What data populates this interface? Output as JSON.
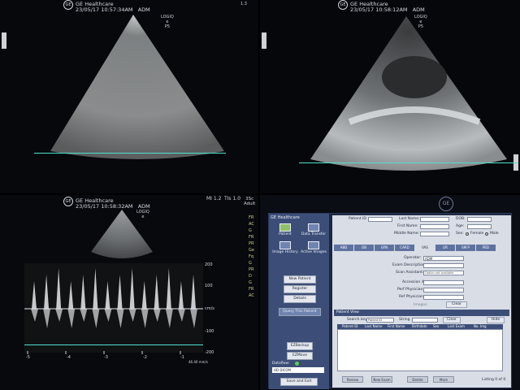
{
  "panel1": {
    "brand": "GE Healthcare",
    "timestamp": "23/05/17 10:57:34AM",
    "operator": "ADM",
    "readout": "1.3",
    "probe_lines": [
      "LOGIQ",
      "e",
      "P5"
    ]
  },
  "panel2": {
    "brand": "GE Healthcare",
    "timestamp": "23/05/17 10:58:12AM",
    "operator": "ADM",
    "probe_lines": [
      "LOGIQ",
      "e",
      "P5"
    ]
  },
  "panel3": {
    "brand": "GE Healthcare",
    "timestamp": "23/05/17 10:58:32AM",
    "operator": "ADM",
    "mi": "MI 1.2",
    "tis": "TIs 1.0",
    "preset_lines": [
      "3Sc",
      "Adult"
    ],
    "probe_lines": [
      "LOGIQ",
      "e"
    ],
    "right_params": [
      "FR",
      "AC",
      "G",
      "FR",
      "PR",
      "Ge",
      "Fq",
      "G",
      "PR",
      "D",
      "G",
      "FR",
      "AC"
    ],
    "scale_labels": [
      "200",
      "100",
      "cm/s",
      "-100",
      "-200"
    ],
    "time_ticks": [
      "-5",
      "-4",
      "-3",
      "-2",
      "-1"
    ],
    "duration": "46.40 mm/s"
  },
  "panel4": {
    "brand": "GE Healthcare",
    "tiles": {
      "patient": "Patient",
      "data_transfer": "Data Transfer",
      "image_history": "Image History",
      "active_images": "Active Images"
    },
    "buttons": {
      "new_patient": "New Patient",
      "register": "Register",
      "details": "Details",
      "query_this_patient": "Query This Patient",
      "ezbackup": "EZBackup",
      "ezmove": "EZMove",
      "save_and_exit": "Save and Exit",
      "clear": "Clear",
      "hide": "Hide",
      "clear_search": "Clear"
    },
    "dataflow_label": "Dataflow:",
    "dataflow_value": "HD DICOM",
    "fields": {
      "patient_id": "Patient ID",
      "last_name": "Last Name:",
      "first_name": "First Name:",
      "middle_name": "Middle Name:",
      "dob": "DOB:",
      "age": "Age:",
      "sex": "Sex:",
      "female": "Female",
      "male": "Male"
    },
    "tabs": [
      "ABD",
      "OB",
      "GYN",
      "CARD",
      "VAS",
      "UR",
      "SM P",
      "PED"
    ],
    "active_tab": 4,
    "exam": {
      "operator_label": "Operator:",
      "operator_value": "ADM",
      "exam_desc": "Exam Description:",
      "scan_assistant": "Scan Assistant:",
      "scan_assistant_value": "Option not available",
      "accession": "Accession #:",
      "perf_physician": "Perf Physician:",
      "ref_physician": "Ref Physician:",
      "images": "Images"
    },
    "patient_view": "Patient View",
    "search_key_label": "Search key",
    "search_key_value": "Patient ID",
    "string_label": "String",
    "table_headers": [
      "Patient ID",
      "Last Name",
      "First Name",
      "Birthdate",
      "Sex",
      "Last Exam",
      "No. Img"
    ],
    "bottom_buttons": [
      "Review",
      "New Exam",
      "Delete",
      "More"
    ],
    "listing": "Listing 0 of 0"
  }
}
